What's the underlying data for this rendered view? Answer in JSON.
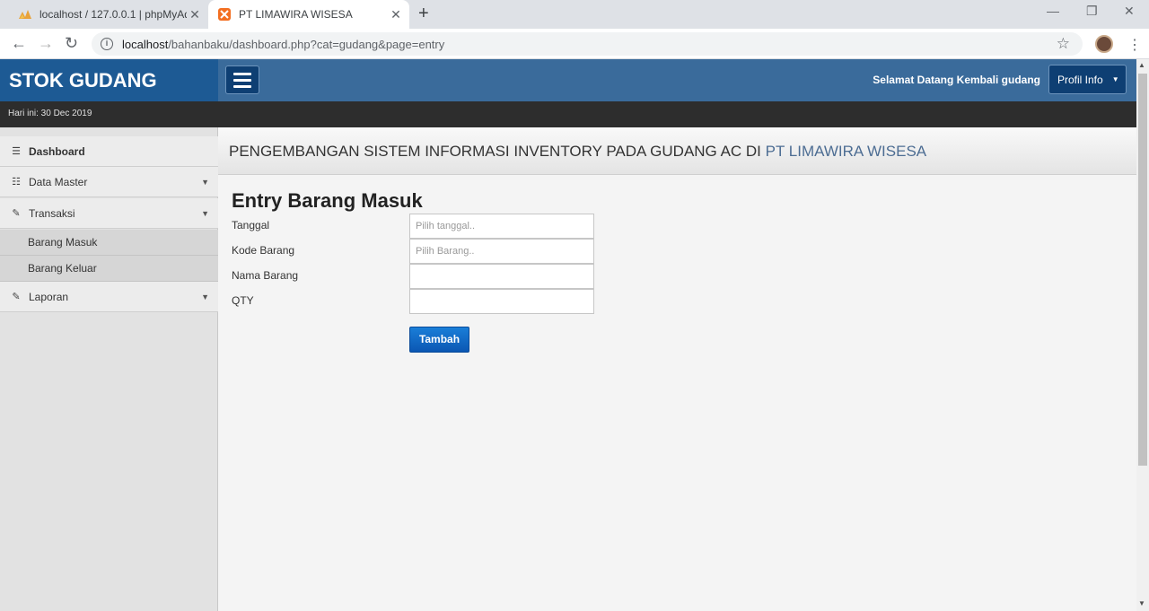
{
  "browser": {
    "tabs": [
      {
        "title": "localhost / 127.0.0.1 | phpMyAdmin",
        "close": "✕"
      },
      {
        "title": "PT LIMAWIRA WISESA",
        "close": "✕"
      }
    ],
    "new_tab": "+",
    "url_host": "localhost",
    "url_path": "/bahanbaku/dashboard.php?cat=gudang&page=entry"
  },
  "app": {
    "brand": "STOK GUDANG",
    "date_text": "Hari ini: 30 Dec 2019",
    "welcome": "Selamat Datang Kembali gudang",
    "profile_button": "Profil Info"
  },
  "sidebar": {
    "items": [
      {
        "label": "Dashboard",
        "icon": "list-icon"
      },
      {
        "label": "Data Master",
        "icon": "grid-list-icon"
      },
      {
        "label": "Transaksi",
        "icon": "pencil-icon"
      },
      {
        "label": "Laporan",
        "icon": "pencil-icon"
      }
    ],
    "subitems": [
      "Barang Masuk",
      "Barang Keluar"
    ]
  },
  "page": {
    "title_prefix": "PENGEMBANGAN SISTEM INFORMASI INVENTORY PADA GUDANG AC DI ",
    "title_highlight": "PT LIMAWIRA WISESA",
    "form_heading": "Entry Barang Masuk",
    "fields": [
      {
        "label": "Tanggal",
        "placeholder": "Pilih tanggal.."
      },
      {
        "label": "Kode Barang",
        "placeholder": "Pilih Barang.."
      },
      {
        "label": "Nama Barang",
        "placeholder": ""
      },
      {
        "label": "QTY",
        "placeholder": ""
      }
    ],
    "submit_label": "Tambah"
  },
  "colors": {
    "brand_bg": "#1d5a94",
    "topbar_bg": "#3a6b9b",
    "button_primary": "#0b57b3",
    "title_highlight": "#4d6d93"
  }
}
